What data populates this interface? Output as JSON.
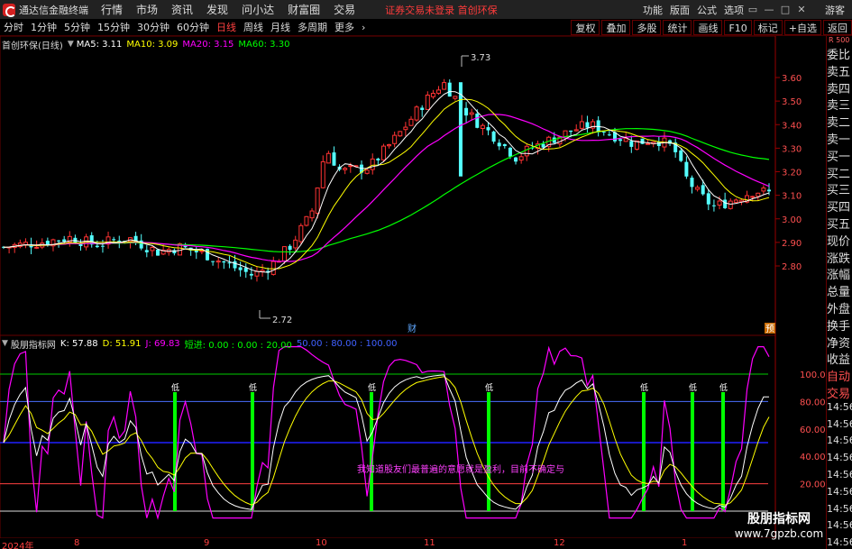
{
  "titlebar": {
    "app_title": "通达信金融终端",
    "menus": [
      "行情",
      "市场",
      "资讯",
      "发现",
      "问小达",
      "财富圈",
      "交易"
    ],
    "warning": "证券交易未登录  首创环保",
    "tools": [
      "功能",
      "版面",
      "公式",
      "选项"
    ],
    "guest": "游客"
  },
  "toolbar": {
    "periods": [
      "分时",
      "1分钟",
      "5分钟",
      "15分钟",
      "30分钟",
      "60分钟",
      "日线",
      "周线",
      "月线",
      "多周期",
      "更多"
    ],
    "active_period": "日线",
    "right_buttons": [
      "复权",
      "叠加",
      "多股",
      "统计",
      "画线",
      "F10",
      "标记",
      "+自选",
      "返回"
    ]
  },
  "main_chart": {
    "name": "首创环保(日线)",
    "ma5": "MA5: 3.11",
    "ma10": "MA10: 3.09",
    "ma20": "MA20: 3.15",
    "ma60": "MA60: 3.30",
    "high_label": "3.73",
    "low_label": "2.72",
    "marker_cai": "财",
    "marker_yu": "预",
    "price_ticks": [
      "3.60",
      "3.50",
      "3.40",
      "3.30",
      "3.20",
      "3.10",
      "3.00",
      "2.90",
      "2.80"
    ],
    "colors": {
      "ma5": "#ffffff",
      "ma10": "#ffff00",
      "ma20": "#ff00ff",
      "ma60": "#00ff00",
      "up": "#ff3333",
      "down": "#54ffff"
    }
  },
  "kdj_panel": {
    "name": "股朋指标网",
    "k": "K: 57.88",
    "d": "D: 51.91",
    "j": "J: 69.83",
    "short_in": "短进: 0.00 : 0.00 : 20.00",
    "levels": "50.00 : 80.00 : 100.00",
    "signal_label": "低",
    "note": "我知道股友们最普遍的意愿就是盈利，目前不确定与",
    "ticks": [
      "100.0",
      "80.00",
      "60.00",
      "40.00",
      "20.00"
    ]
  },
  "x_axis": [
    "2024年",
    "8",
    "9",
    "10",
    "11",
    "12",
    "1"
  ],
  "side_panel": {
    "tag": "R 500",
    "labels": [
      "委比",
      "卖五",
      "卖四",
      "卖三",
      "卖二",
      "卖一",
      "买一",
      "买二",
      "买三",
      "买四",
      "买五",
      "现价",
      "涨跌",
      "涨幅",
      "总量",
      "外盘",
      "换手",
      "净资",
      "收益",
      "自动",
      "交易",
      "14:56",
      "14:56",
      "14:56",
      "14:56",
      "14:56",
      "14:56",
      "14:56",
      "14:56",
      "14:56"
    ]
  },
  "watermark": {
    "line1": "股朋指标网",
    "line2": "www.7gpzb.com"
  }
}
